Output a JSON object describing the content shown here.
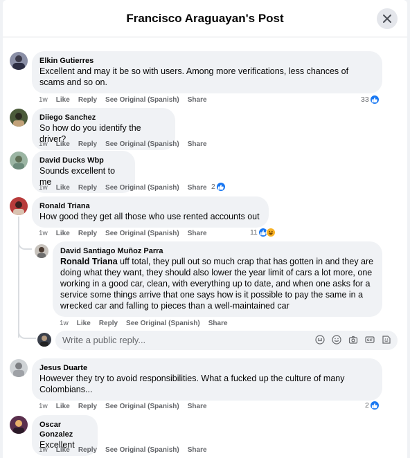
{
  "header": {
    "title": "Francisco Araguayan's Post"
  },
  "action_labels": {
    "like": "Like",
    "reply": "Reply",
    "see_original": "See Original (Spanish)",
    "share": "Share"
  },
  "comments": [
    {
      "author": "Elkin Gutierres",
      "text": "Excellent and may it be so with users. Among more verifications, less chances of scams and so on.",
      "time": "1w",
      "reactions": "33"
    },
    {
      "author": "Diiego Sanchez",
      "text": "So how do you identify the driver?",
      "time": "1w",
      "reactions": ""
    },
    {
      "author": "David Ducks Wbp",
      "text": "Sounds excellent to me",
      "time": "1w",
      "reactions": "2"
    },
    {
      "author": "Ronald Triana",
      "text": "How good they get all those who use rented accounts out",
      "time": "1w",
      "reactions": "11"
    },
    {
      "author": "Jesus Duarte",
      "text": "However they try to avoid responsibilities. What a fucked up the culture of many Colombians...",
      "time": "1w",
      "reactions": "2"
    },
    {
      "author": "Oscar Gonzalez",
      "text": "Excellent",
      "time": "1w",
      "reactions": ""
    }
  ],
  "reply": {
    "author": "David Santiago Muñoz Parra",
    "mention": "Ronald Triana",
    "text": " uff total, they pull out so much crap that has gotten in and they are doing what they want, they should also lower the year limit of cars a lot more, one working in a good car, clean, with everything up to date, and when one asks for a service some things arrive that one says how is it possible to pay the same in a wrecked car and falling to pieces than a well-maintained car",
    "time": "1w"
  },
  "reply_input": {
    "placeholder": "Write a public reply..."
  },
  "icons": [
    "close-icon",
    "like-icon",
    "haha-icon",
    "avatar-sticker-icon",
    "emoji-icon",
    "camera-icon",
    "gif-icon",
    "sticker-icon"
  ],
  "colors": {
    "accent": "#1877f2",
    "bubble": "#f0f2f5",
    "meta": "#65676b"
  }
}
